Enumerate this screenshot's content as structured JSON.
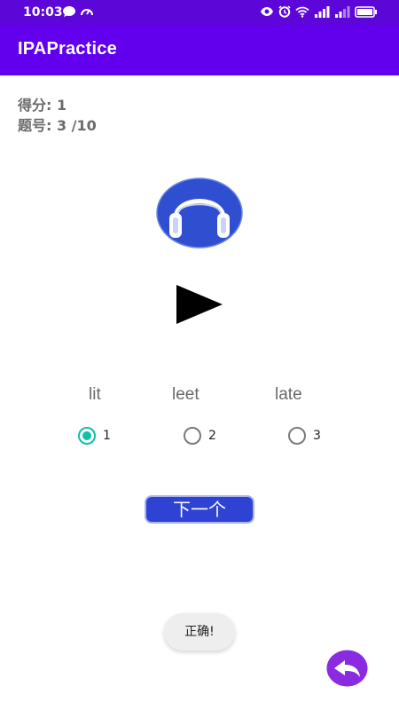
{
  "status_bar": {
    "time": "10:03",
    "bg_color": "#5d06d8",
    "left_icons": [
      "message-icon",
      "speedometer-icon"
    ],
    "right_icons": [
      "eye-icon",
      "alarm-icon",
      "wifi-icon",
      "signal-icon",
      "signal-icon",
      "battery-icon"
    ]
  },
  "app_bar": {
    "title": "IPAPractice",
    "bg_color": "#6200ee"
  },
  "quiz": {
    "score_text": "得分: 1",
    "question_text": "题号: 3 /10"
  },
  "media": {
    "badge_icon": "headphones-icon",
    "play_icon": "play-icon"
  },
  "options": [
    {
      "word": "lit",
      "number": "1",
      "selected": true
    },
    {
      "word": "leet",
      "number": "2",
      "selected": false
    },
    {
      "word": "late",
      "number": "3",
      "selected": false
    }
  ],
  "next_button": {
    "label": "下一个",
    "color": "#2e43d4"
  },
  "toast": {
    "text": "正确!"
  },
  "back_button": {
    "icon": "reply-arrow-icon",
    "color": "#8a2be2"
  },
  "colors": {
    "accent": "#0fbfa9",
    "headphone_badge": "#2f4fd0"
  }
}
